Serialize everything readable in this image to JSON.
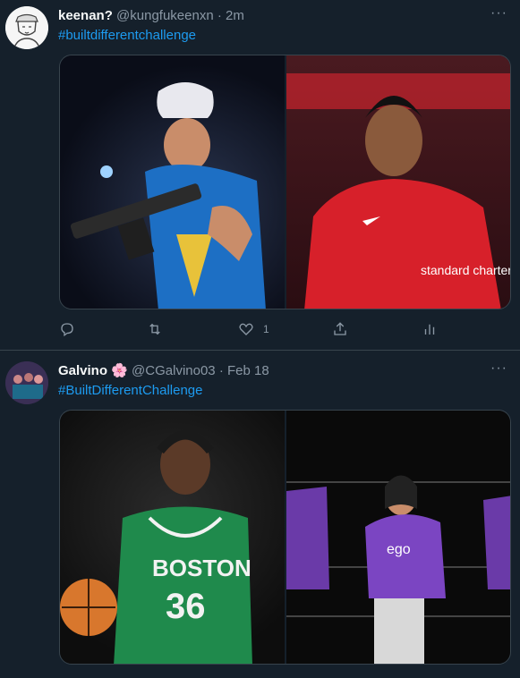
{
  "tweets": [
    {
      "name": "keenan?",
      "handle": "@kungfukeenxn",
      "time": "2m",
      "hashtag": "#builtdifferentchallenge",
      "likes": "1",
      "images": [
        "cosplayer with rifle",
        "Liverpool player in red kit"
      ],
      "left_image_text": "",
      "right_image_text": "standard chartered"
    },
    {
      "name": "Galvino",
      "emoji": "🌸",
      "handle": "@CGalvino03",
      "time": "Feb 18",
      "hashtag": "#BuiltDifferentChallenge",
      "images": [
        "Boston basketball player",
        "wrestlers in purple shirts"
      ],
      "left_image_text": "BOSTON",
      "left_image_number": "36",
      "right_image_text": "ego"
    }
  ],
  "sep": "·",
  "more_label": "···",
  "colors": {
    "bg": "#15202b",
    "link": "#1d9bf0",
    "muted": "#8b98a5",
    "border": "#38444d"
  },
  "icons": [
    "reply-icon",
    "retweet-icon",
    "like-icon",
    "share-icon",
    "analytics-icon",
    "more-icon"
  ]
}
